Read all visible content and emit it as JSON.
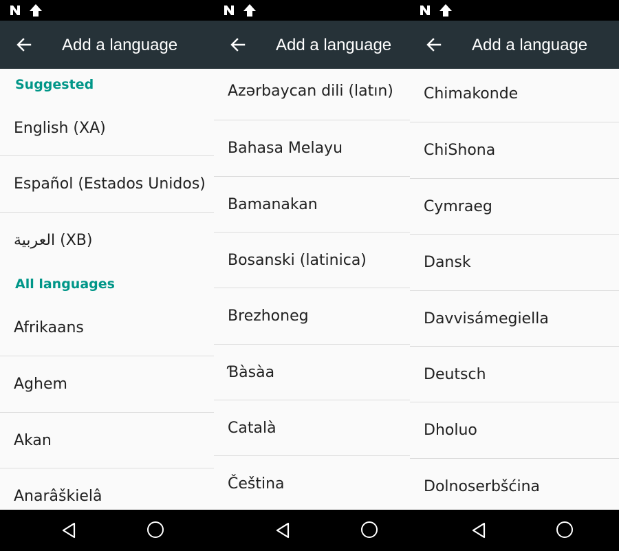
{
  "app_title": "Add a language",
  "colors": {
    "appbar": "#263238",
    "accent": "#009688"
  },
  "icons": {
    "back": "arrow-back-icon",
    "home": "home-circle-icon",
    "nav_back": "triangle-back-icon"
  },
  "panel1": {
    "section_suggested": "Suggested",
    "suggested": [
      "English (XA)",
      "Español (Estados Unidos)",
      "العربية (XB)"
    ],
    "section_all": "All languages",
    "all": [
      "Afrikaans",
      "Aghem",
      "Akan",
      "Anarâškielâ"
    ]
  },
  "panel2": {
    "items": [
      "Azərbaycan dili (latın)",
      "Bahasa Melayu",
      "Bamanakan",
      "Bosanski (latinica)",
      "Brezhoneg",
      "Ɓàsàa",
      "Català",
      "Čeština"
    ]
  },
  "panel3": {
    "items": [
      "Chimakonde",
      "ChiShona",
      "Cymraeg",
      "Dansk",
      "Davvisámegiella",
      "Deutsch",
      "Dholuo",
      "Dolnoserbšćina"
    ]
  }
}
